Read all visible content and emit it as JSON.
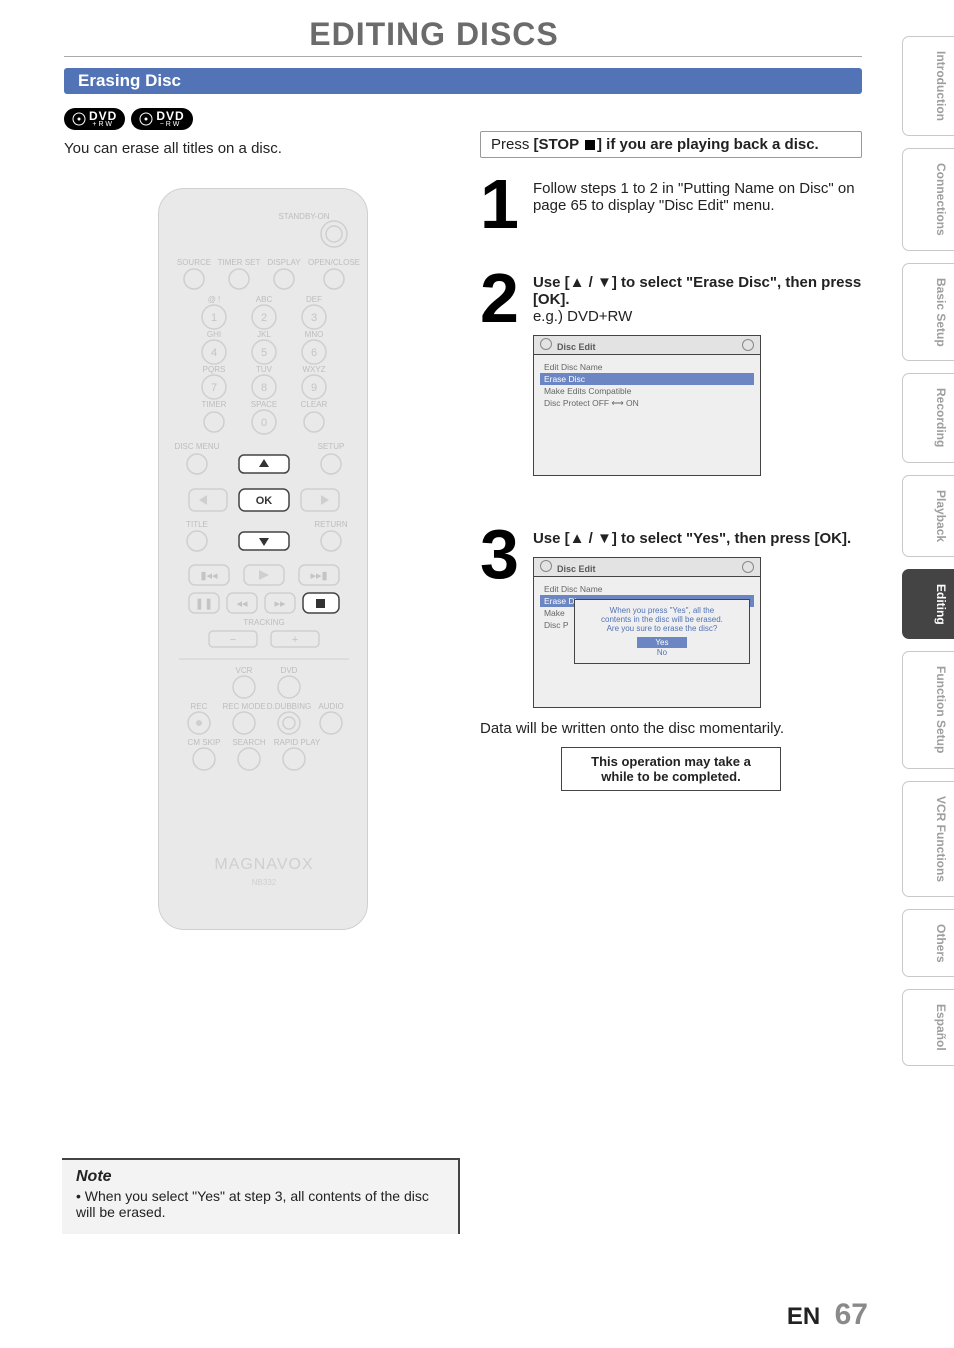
{
  "page_title": "EDITING DISCS",
  "section_title": "Erasing Disc",
  "badges": [
    {
      "line1": "DVD",
      "line2": "+RW"
    },
    {
      "line1": "DVD",
      "line2": "−RW"
    }
  ],
  "intro_text": "You can erase all titles on a disc.",
  "press_stop": {
    "pre": "Press ",
    "bold": "[STOP ",
    "post": "] if you are playing back a disc."
  },
  "remote": {
    "standby": "STANDBY-ON",
    "row1": [
      "SOURCE",
      "TIMER SET",
      "DISPLAY",
      "OPEN/CLOSE"
    ],
    "row_abc": [
      "@ !",
      "ABC",
      "DEF"
    ],
    "row_ghi": [
      "GHI",
      "JKL",
      "MNO"
    ],
    "row_pqrs": [
      "PQRS",
      "TUV",
      "WXYZ"
    ],
    "row_timer": [
      "TIMER",
      "SPACE",
      "CLEAR"
    ],
    "disc_menu": "DISC MENU",
    "setup": "SETUP",
    "ok": "OK",
    "title": "TITLE",
    "return": "RETURN",
    "tracking": "TRACKING",
    "minus": "−",
    "plus": "+",
    "vcr": "VCR",
    "dvd": "DVD",
    "row_rec": [
      "REC",
      "REC MODE",
      "D.DUBBING",
      "AUDIO"
    ],
    "row_cm": [
      "CM SKIP",
      "SEARCH",
      "RAPID PLAY"
    ],
    "brand": "MAGNAVOX",
    "model": "NB332"
  },
  "step1": {
    "num": "1",
    "text": "Follow steps 1 to 2 in \"Putting Name on Disc\" on page 65 to display \"Disc Edit\" menu."
  },
  "step2": {
    "num": "2",
    "line1_pre": "Use [",
    "line1_mid": " / ",
    "line1_post": "] to select \"Erase Disc\", then press [OK].",
    "eg": "e.g.) DVD+RW",
    "osd_title": "Disc Edit",
    "rows": [
      "Edit Disc Name",
      "Erase Disc",
      "Make Edits Compatible",
      "Disc Protect OFF ⟷ ON"
    ]
  },
  "step3": {
    "num": "3",
    "line1_pre": "Use [",
    "line1_mid": " / ",
    "line1_post": "] to select \"Yes\", then press [OK].",
    "osd_title": "Disc Edit",
    "rows_bg": [
      "Edit Disc Name",
      "Erase Disc",
      "Make",
      "Disc P"
    ],
    "popup1": "When you press \"Yes\", all the",
    "popup2": "contents in the disc will be erased.",
    "popup3": "Are you sure to erase the disc?",
    "yes": "Yes",
    "no": "No",
    "result": "Data will be written onto the disc momentarily.",
    "box1": "This operation may take a",
    "box2": "while to be completed."
  },
  "note": {
    "title": "Note",
    "body": "• When you select \"Yes\" at step 3, all contents of the disc will be erased."
  },
  "tabs": [
    "Introduction",
    "Connections",
    "Basic Setup",
    "Recording",
    "Playback",
    "Editing",
    "Function Setup",
    "VCR Functions",
    "Others",
    "Español"
  ],
  "active_tab_index": 5,
  "footer": {
    "lang": "EN",
    "page": "67"
  }
}
